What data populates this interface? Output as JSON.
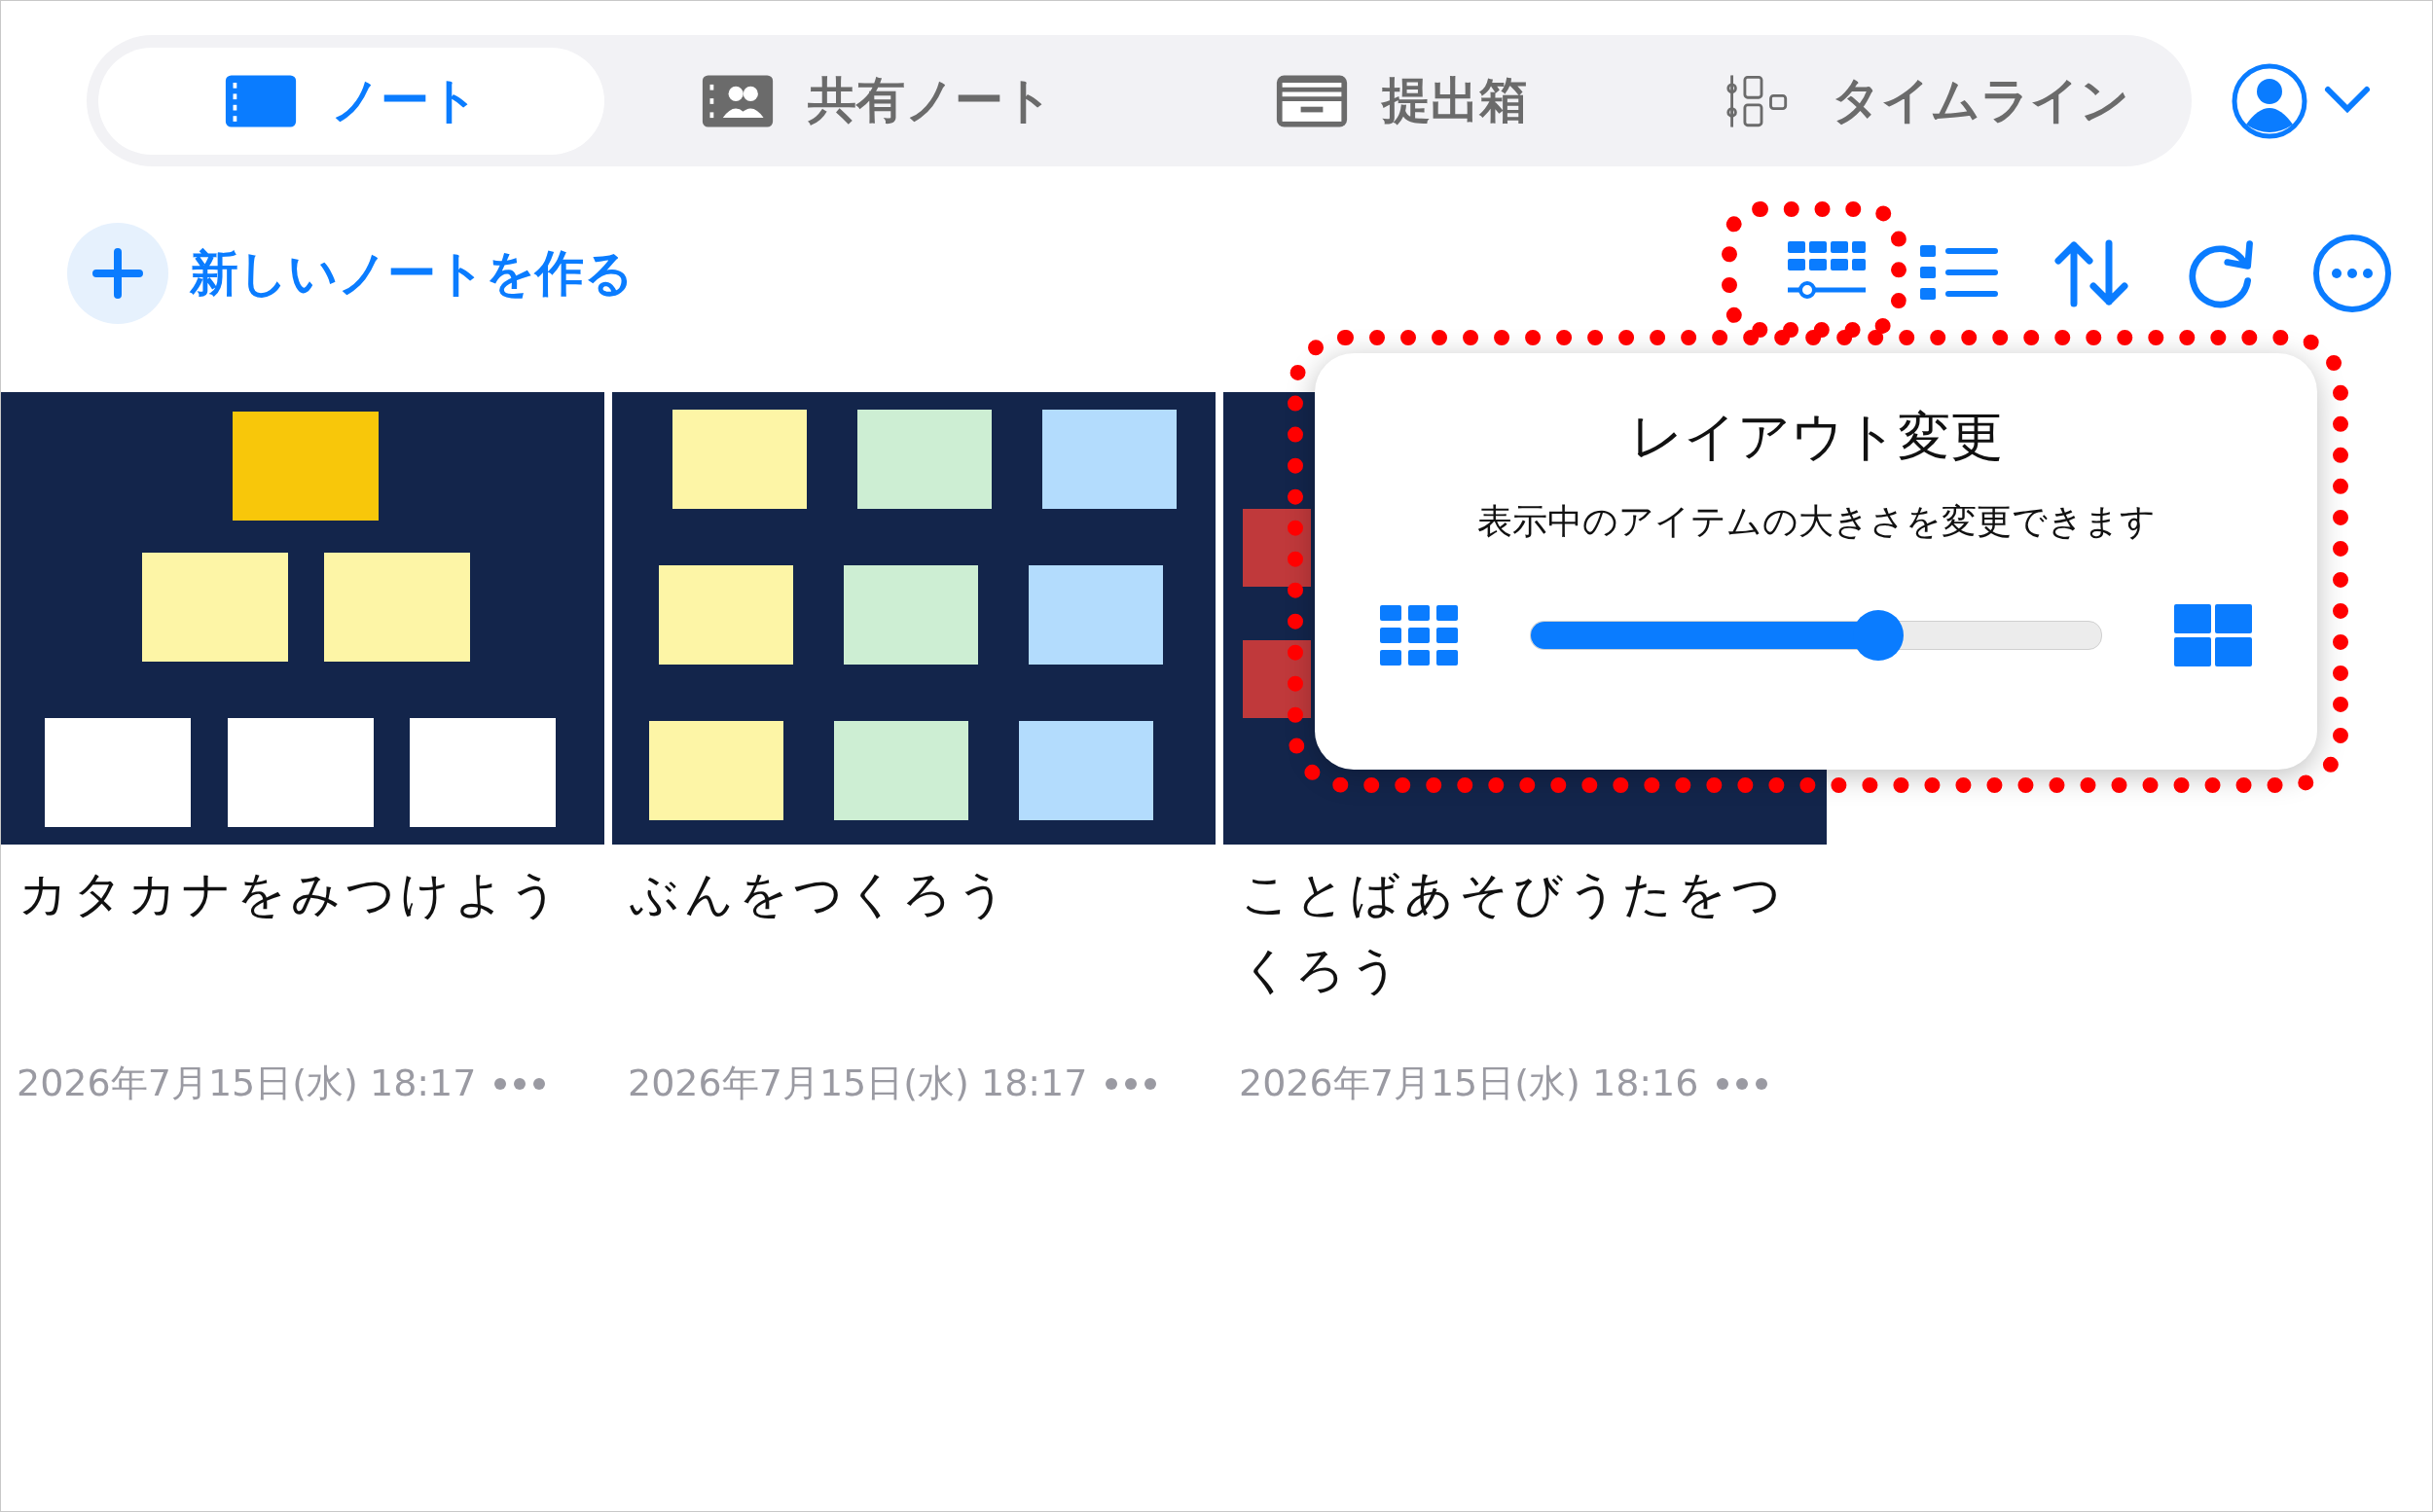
{
  "tabs": [
    {
      "label": "ノート",
      "selected": true
    },
    {
      "label": "共有ノート",
      "selected": false
    },
    {
      "label": "提出箱",
      "selected": false
    },
    {
      "label": "タイムライン",
      "selected": false
    }
  ],
  "new_note_button": {
    "label": "新しいノートを作る"
  },
  "notes": [
    {
      "title": "カタカナをみつけよう",
      "date": "2026年7月15日(水) 18:17",
      "kind": "pyramid"
    },
    {
      "title": "ぶんをつくろう",
      "date": "2026年7月15日(水) 18:17",
      "kind": "grid"
    },
    {
      "title": "ことばあそびうたをつくろう",
      "date": "2026年7月15日(水) 18:16",
      "kind": "partial"
    }
  ],
  "popover": {
    "title": "レイアウト変更",
    "description": "表示中のアイテムの大きさを変更できます",
    "size_slider": {
      "level": 0.61
    }
  }
}
